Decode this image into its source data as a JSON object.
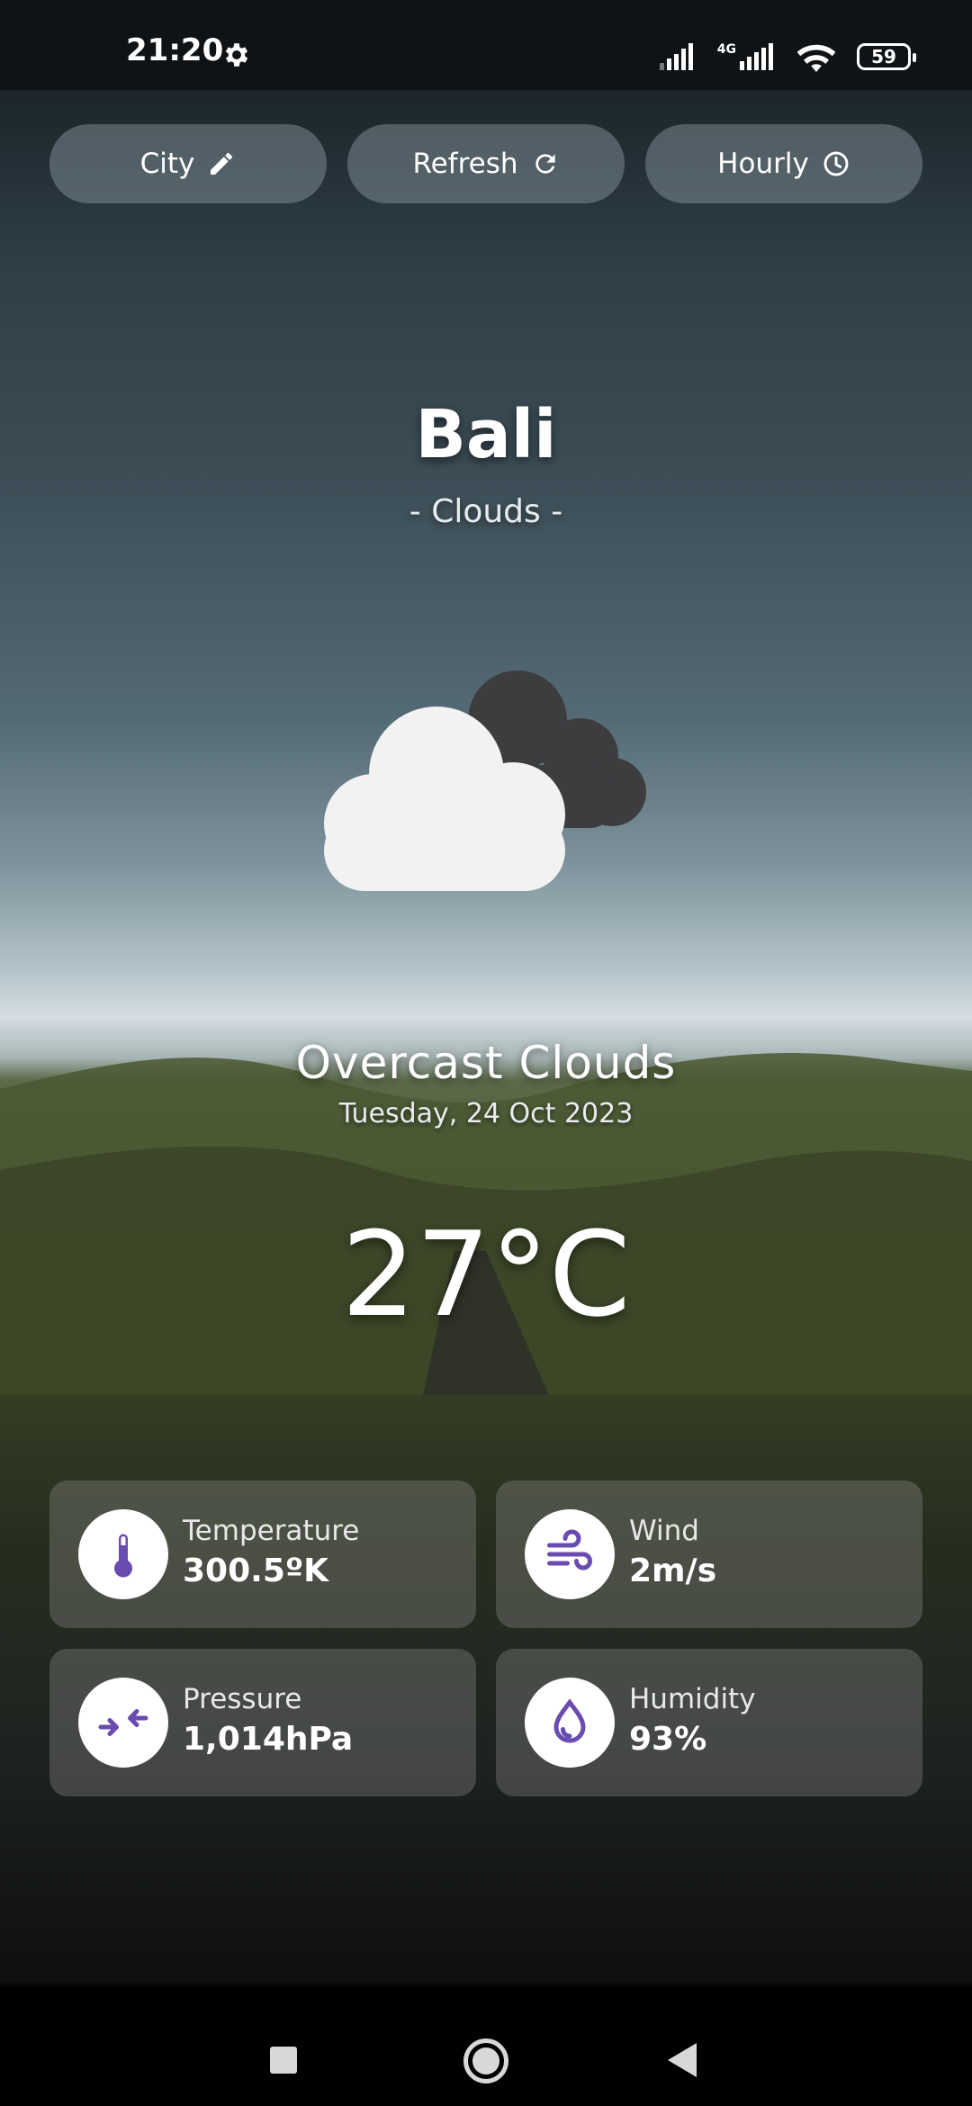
{
  "status_bar": {
    "time": "21:20",
    "network_label": "4G",
    "battery": "59"
  },
  "toolbar": {
    "city_label": "City",
    "refresh_label": "Refresh",
    "hourly_label": "Hourly"
  },
  "location": {
    "city": "Bali",
    "main_condition": "- Clouds -"
  },
  "weather": {
    "icon": "cloud-icon",
    "description": "Overcast Clouds",
    "date": "Tuesday, 24 Oct 2023",
    "temperature": "27°C"
  },
  "details": [
    {
      "label": "Temperature",
      "value": "300.5ºK",
      "icon": "thermometer-icon"
    },
    {
      "label": "Wind",
      "value": "2m/s",
      "icon": "wind-icon"
    },
    {
      "label": "Pressure",
      "value": "1,014hPa",
      "icon": "compress-icon"
    },
    {
      "label": "Humidity",
      "value": "93%",
      "icon": "water-drop-icon"
    }
  ],
  "colors": {
    "accent": "#6a4bb0",
    "card_bg": "#8c8c8c",
    "button_bg": "#8a9aa2"
  }
}
